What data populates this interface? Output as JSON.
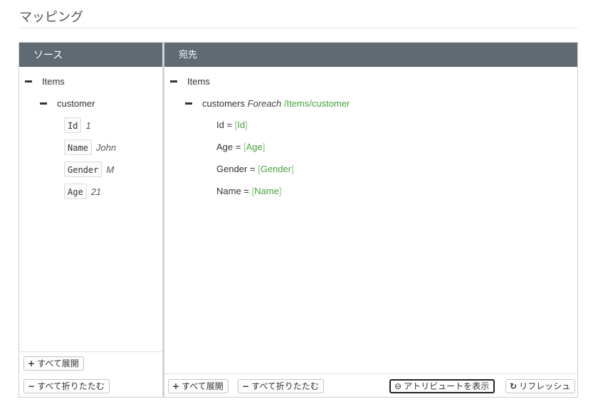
{
  "page": {
    "title": "マッピング"
  },
  "source": {
    "header": "ソース",
    "root": "Items",
    "child": "customer",
    "attributes": [
      {
        "name": "Id",
        "value": "1"
      },
      {
        "name": "Name",
        "value": "John"
      },
      {
        "name": "Gender",
        "value": "M"
      },
      {
        "name": "Age",
        "value": "21"
      }
    ],
    "buttons": {
      "expand_all": "すべて展開",
      "collapse_all": "すべて折りたたむ"
    }
  },
  "destination": {
    "header": "宛先",
    "root": "Items",
    "child": {
      "name": "customers",
      "keyword": "Foreach",
      "path": "/Items/customer"
    },
    "mappings": [
      {
        "label": "Id =",
        "open": "[",
        "ref": "Id",
        "close": "]"
      },
      {
        "label": "Age =",
        "open": "[",
        "ref": "Age",
        "close": "]"
      },
      {
        "label": "Gender =",
        "open": "[",
        "ref": "Gender",
        "close": "]"
      },
      {
        "label": "Name =",
        "open": "[",
        "ref": "Name",
        "close": "]"
      }
    ],
    "buttons": {
      "expand_all": "すべて展開",
      "collapse_all": "すべて折りたたむ",
      "show_attributes": "アトリビュートを表示",
      "refresh": "リフレッシュ"
    }
  },
  "icons": {
    "plus": "+",
    "minus": "−",
    "toggle": "⊖",
    "refresh": "↻"
  },
  "colors": {
    "header_bg": "#5f6a72",
    "link_green": "#48a23f"
  }
}
